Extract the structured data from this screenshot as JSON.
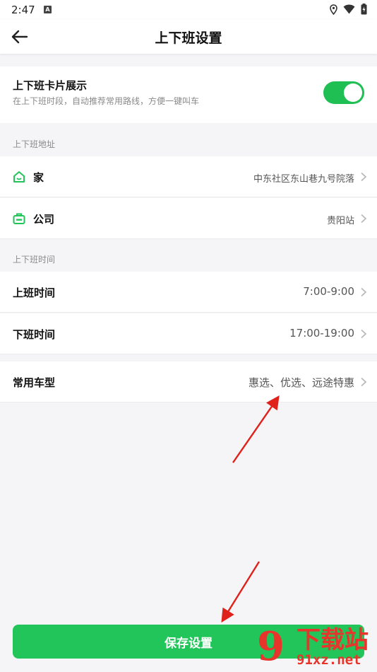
{
  "status_bar": {
    "time": "2:47",
    "app_icon_letter": "A",
    "icons": [
      "location-icon",
      "wifi-icon",
      "battery-icon"
    ]
  },
  "header": {
    "title": "上下班设置",
    "back_icon": "arrow-left-icon"
  },
  "commute_card": {
    "title": "上下班卡片展示",
    "subtitle": "在上下班时段，自动推荐常用路线，方便一键叫车",
    "toggle_on": true
  },
  "address_section": {
    "label": "上下班地址",
    "items": [
      {
        "icon": "home-icon",
        "label": "家",
        "value": "中东社区东山巷九号院落"
      },
      {
        "icon": "briefcase-icon",
        "label": "公司",
        "value": "贵阳站"
      }
    ]
  },
  "time_section": {
    "label": "上下班时间",
    "items": [
      {
        "label": "上班时间",
        "value": "7:00-9:00"
      },
      {
        "label": "下班时间",
        "value": "17:00-19:00"
      }
    ]
  },
  "car_type": {
    "label": "常用车型",
    "value": "惠选、优选、远途特惠"
  },
  "save_button": {
    "label": "保存设置"
  },
  "watermark": {
    "big": "下载站",
    "small": "91xz.net",
    "mark": "9"
  },
  "colors": {
    "accent_green": "#22c55a",
    "toggle_green": "#1fbf54",
    "annotation_red": "#e0201b"
  }
}
